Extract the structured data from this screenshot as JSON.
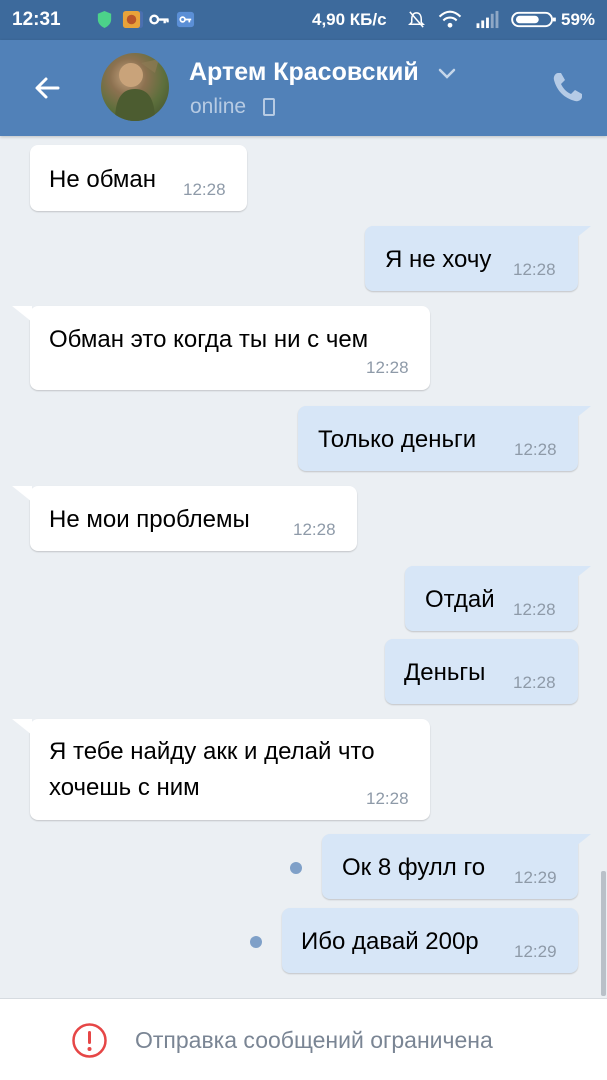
{
  "status_bar": {
    "time": "12:31",
    "net_rate": "4,90 КБ/с",
    "battery": "59%"
  },
  "header": {
    "contact_name": "Артем Красовский",
    "status": "online",
    "colors": {
      "bar": "#5181b8",
      "status_bar": "#3d6a9c"
    }
  },
  "messages": [
    {
      "dir": "in",
      "text": "Не обман",
      "time": "12:28"
    },
    {
      "dir": "out",
      "text": "Я не хочу",
      "time": "12:28"
    },
    {
      "dir": "in",
      "text": "Обман это когда ты ни с чем",
      "time": "12:28"
    },
    {
      "dir": "out",
      "text": "Только деньги",
      "time": "12:28"
    },
    {
      "dir": "in",
      "text": "Не мои проблемы",
      "time": "12:28"
    },
    {
      "dir": "out",
      "text": "Отдай",
      "time": "12:28"
    },
    {
      "dir": "out",
      "text": "Деньгы",
      "time": "12:28"
    },
    {
      "dir": "in",
      "text_line1": "Я тебе найду акк и делай что",
      "text_line2": "хочешь с ним",
      "time": "12:28"
    },
    {
      "dir": "out",
      "text": "Ок 8 фулл го",
      "time": "12:29",
      "unread": true
    },
    {
      "dir": "out",
      "text": "Ибо давай 200р",
      "time": "12:29",
      "unread": true
    }
  ],
  "footer": {
    "restricted_text": "Отправка сообщений ограничена"
  }
}
